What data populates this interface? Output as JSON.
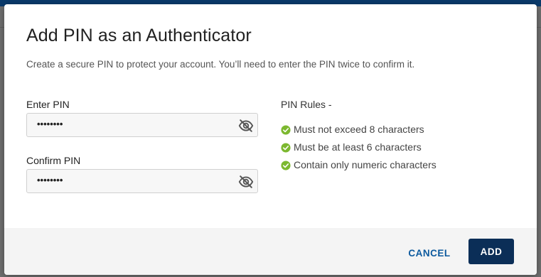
{
  "dialog": {
    "title": "Add PIN as an Authenticator",
    "description": "Create a secure PIN to protect your account. You’ll need to enter the PIN twice to confirm it."
  },
  "fields": {
    "enter_pin": {
      "label": "Enter PIN",
      "masked_value": "••••••••",
      "toggle_icon": "eye-slash-icon"
    },
    "confirm_pin": {
      "label": "Confirm PIN",
      "masked_value": "••••••••",
      "toggle_icon": "eye-slash-icon"
    }
  },
  "pin_rules": {
    "title": "PIN Rules -",
    "items": [
      {
        "text": "Must not exceed 8 characters",
        "status": "met",
        "icon": "check-circle-icon"
      },
      {
        "text": "Must be at least 6 characters",
        "status": "met",
        "icon": "check-circle-icon"
      },
      {
        "text": "Contain only numeric characters",
        "status": "met",
        "icon": "check-circle-icon"
      }
    ]
  },
  "actions": {
    "cancel_label": "CANCEL",
    "add_label": "ADD"
  },
  "colors": {
    "primary_button": "#0b2e57",
    "link": "#0d5a9e",
    "success": "#7cb82f",
    "header_bar": "#0a3a6b"
  }
}
